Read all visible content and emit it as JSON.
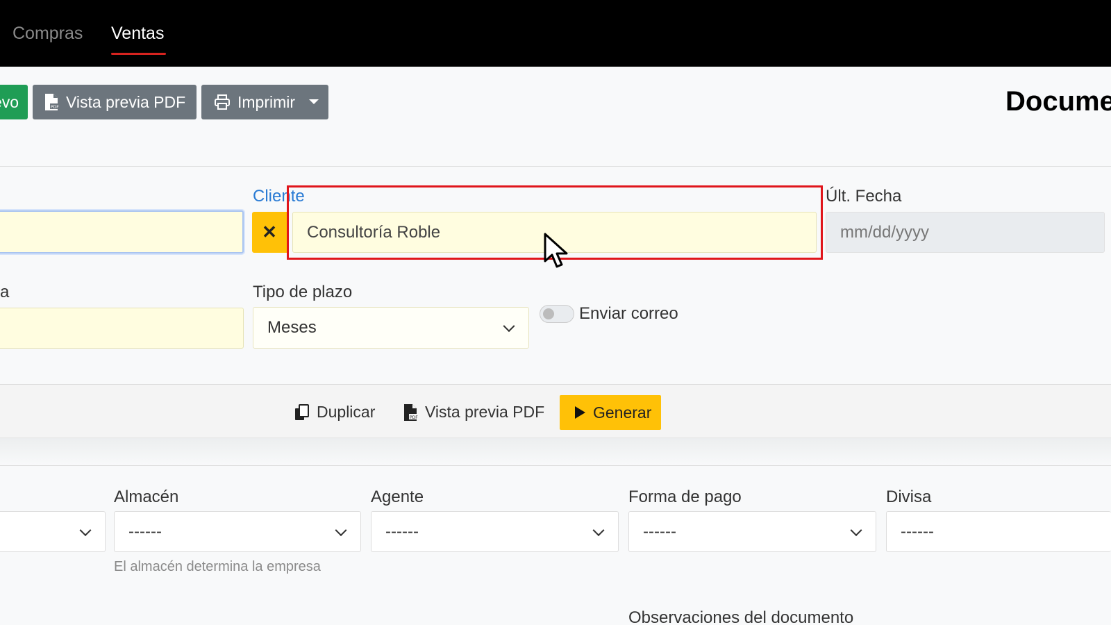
{
  "nav": {
    "items": [
      {
        "label": "Compras",
        "active": false
      },
      {
        "label": "Ventas",
        "active": true
      }
    ],
    "accent": "#d6231f"
  },
  "toolbar": {
    "new_label": "evo",
    "pdf_preview_label": "Vista previa PDF",
    "print_label": "Imprimir",
    "title": "Docume"
  },
  "form": {
    "cliente": {
      "label": "Cliente",
      "value": "Consultoría Roble",
      "clear_icon": "✕"
    },
    "ult_fecha": {
      "label": "Últ. Fecha",
      "placeholder": "mm/dd/yyyy"
    },
    "left_label": "a",
    "tipo_plazo": {
      "label": "Tipo de plazo",
      "value": "Meses"
    },
    "enviar_correo": {
      "label": "Enviar correo",
      "checked": false
    }
  },
  "actions": {
    "duplicate_label": "Duplicar",
    "pdf_preview_label": "Vista previa PDF",
    "generate_label": "Generar",
    "generate_color": "#ffc107"
  },
  "details": {
    "almacen": {
      "label": "Almacén",
      "value": "------",
      "help": "El almacén determina la empresa"
    },
    "agente": {
      "label": "Agente",
      "value": "------"
    },
    "forma_pago": {
      "label": "Forma de pago",
      "value": "------"
    },
    "divisa": {
      "label": "Divisa",
      "value": "------"
    },
    "observaciones_label": "Observaciones del documento"
  }
}
